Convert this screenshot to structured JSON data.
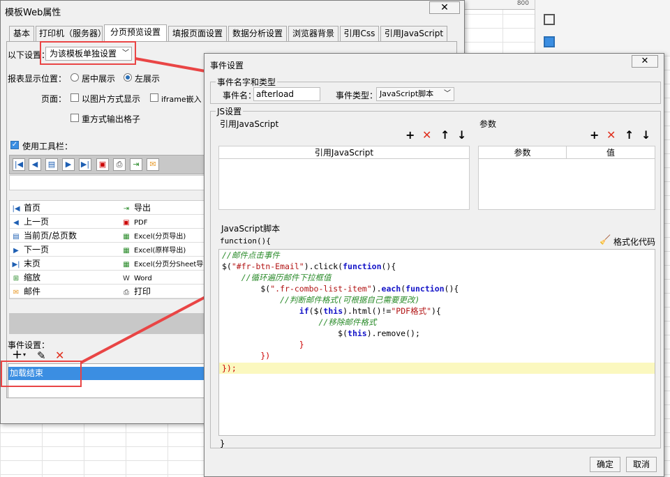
{
  "background": {
    "ruler_mark": "800"
  },
  "main_dialog": {
    "title": "模板Web属性",
    "close_glyph": "✕",
    "tabs": [
      "基本",
      "打印机（服务器）",
      "分页预览设置",
      "填报页面设置",
      "数据分析设置",
      "浏览器背景",
      "引用Css",
      "引用JavaScript"
    ],
    "setting_label": "以下设置：",
    "setting_value": "为该模板单独设置",
    "position_label": "报表显示位置：",
    "position_options": [
      "居中展示",
      "左展示"
    ],
    "page_label": "页面：",
    "page_options": [
      "以图片方式显示",
      "iframe嵌入",
      "重方式输出格子"
    ],
    "use_toolbar": "使用工具栏：",
    "toolbar_items_left": [
      "首页",
      "上一页",
      "当前页/总页数",
      "下一页",
      "末页",
      "缩放",
      "邮件"
    ],
    "toolbar_items_right": [
      "导出",
      "PDF",
      "Excel(分页导出)",
      "Excel(原样导出)",
      "Excel(分页分Sheet导出)",
      "Word",
      "打印"
    ],
    "event_settings_label": "事件设置：",
    "event_item": "加载结束"
  },
  "event_dialog": {
    "title": "事件设置",
    "close_glyph": "✕",
    "name_type_group": "事件名字和类型",
    "event_name_label": "事件名：",
    "event_name_value": "afterload",
    "event_type_label": "事件类型：",
    "event_type_value": "JavaScript脚本",
    "js_group": "JS设置",
    "ref_js_label": "引用JavaScript",
    "params_label": "参数",
    "ref_js_column": "引用JavaScript",
    "params_columns": [
      "参数",
      "值"
    ],
    "script_label": "JavaScript脚本",
    "function_open": "function(){",
    "format_code": "格式化代码",
    "function_close": "}",
    "ok_button": "确定",
    "cancel_button": "取消",
    "code_lines": [
      "//邮件点击事件",
      "$(\"#fr-btn-Email\").click(function(){",
      "    //循环遍历邮件下拉框值",
      "        $(\".fr-combo-list-item\").each(function(){",
      "            //判断邮件格式(可根据自己需要更改)",
      "                if($(this).html()!=\"PDF格式\"){",
      "                    //移除邮件格式",
      "                        $(this).remove();",
      "                }",
      "        })",
      "});"
    ]
  },
  "colors": {
    "accent": "#3b8ee2",
    "highlight_box": "#e94545",
    "code_comment": "#2a8b2a",
    "code_keyword": "#1414c8"
  }
}
